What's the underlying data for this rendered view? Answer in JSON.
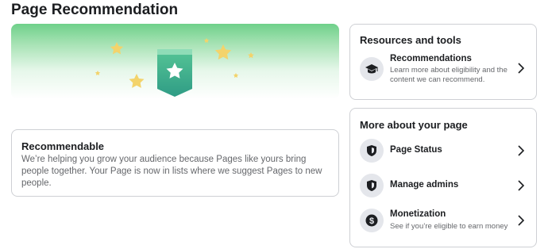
{
  "page_title": "Page Recommendation",
  "recommendable": {
    "title": "Recommendable",
    "description": "We’re helping you grow your audience because Pages like yours bring people together. Your Page is now in lists where we suggest Pages to new people."
  },
  "resources": {
    "heading": "Resources and tools",
    "items": [
      {
        "label": "Recommendations",
        "sub": "Learn more about eligibility and the content we can recommend.",
        "icon": "graduation-cap-icon"
      }
    ]
  },
  "more": {
    "heading": "More about your page",
    "items": [
      {
        "label": "Page Status",
        "icon": "shield-icon"
      },
      {
        "label": "Manage admins",
        "icon": "shield-icon"
      },
      {
        "label": "Monetization",
        "sub": "See if you’re eligible to earn money",
        "icon": "dollar-icon"
      }
    ]
  },
  "colors": {
    "hero_green": "#6fd08a",
    "badge_teal": "#3fb58e",
    "star_yellow": "#f3d36b",
    "text_secondary": "#65676b",
    "border": "#ced0d4"
  }
}
